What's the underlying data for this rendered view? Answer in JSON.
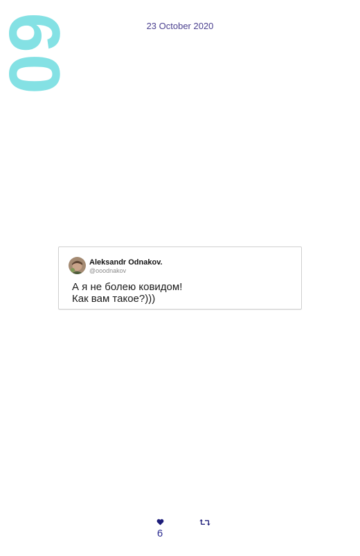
{
  "page": {
    "number": "60",
    "date": "23 October 2020"
  },
  "tweet": {
    "author_name": "Aleksandr Odnakov.",
    "author_handle": "@ooodnakov",
    "text_lines": [
      "А я не болею ковидом!",
      "Как вам такое?)))"
    ]
  },
  "stats": {
    "likes": "6",
    "like_icon": "heart-icon",
    "retweet_icon": "retweet-icon"
  },
  "colors": {
    "page_number": "#84e1e4",
    "date_text": "#4a3f8f",
    "icons": "#1d1d7a"
  }
}
